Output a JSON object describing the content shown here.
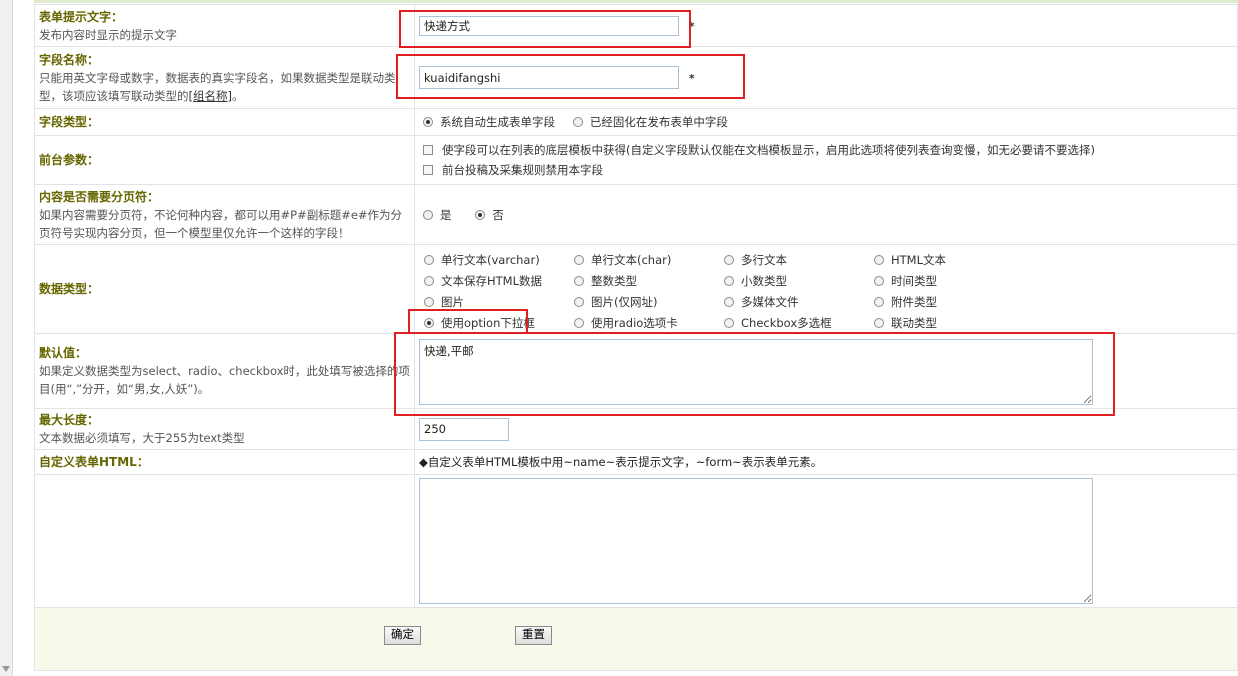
{
  "fields": {
    "prompt_text": {
      "label": "表单提示文字：",
      "desc": "发布内容时显示的提示文字",
      "value": "快递方式",
      "required": "*"
    },
    "field_name": {
      "label": "字段名称：",
      "desc": "只能用英文字母或数字，数据表的真实字段名，如果数据类型是联动类型，该项应该填写联动类型的",
      "desc_link": "[组名称]",
      "desc_end": "。",
      "value": "kuaidifangshi",
      "required": "*"
    },
    "field_type": {
      "label": "字段类型：",
      "options": [
        {
          "label": "系统自动生成表单字段",
          "checked": true
        },
        {
          "label": "已经固化在发布表单中字段",
          "checked": false
        }
      ]
    },
    "front_params": {
      "label": "前台参数：",
      "options": [
        {
          "label": "使字段可以在列表的底层模板中获得(自定义字段默认仅能在文档模板显示，启用此选项将使列表查询变慢，如无必要请不要选择)",
          "checked": false
        },
        {
          "label": "前台投稿及采集规则禁用本字段",
          "checked": false
        }
      ]
    },
    "page_break": {
      "label": "内容是否需要分页符：",
      "desc": "如果内容需要分页符，不论何种内容，都可以用#P#副标题#e#作为分页符号实现内容分页，但一个模型里仅允许一个这样的字段！",
      "options": [
        {
          "label": "是",
          "checked": false
        },
        {
          "label": "否",
          "checked": true
        }
      ]
    },
    "data_type": {
      "label": "数据类型：",
      "options": [
        {
          "label": "单行文本(varchar)",
          "checked": false
        },
        {
          "label": "单行文本(char)",
          "checked": false
        },
        {
          "label": "多行文本",
          "checked": false
        },
        {
          "label": "HTML文本",
          "checked": false
        },
        {
          "label": "文本保存HTML数据",
          "checked": false
        },
        {
          "label": "整数类型",
          "checked": false
        },
        {
          "label": "小数类型",
          "checked": false
        },
        {
          "label": "时间类型",
          "checked": false
        },
        {
          "label": "图片",
          "checked": false
        },
        {
          "label": "图片(仅网址)",
          "checked": false
        },
        {
          "label": "多媒体文件",
          "checked": false
        },
        {
          "label": "附件类型",
          "checked": false
        },
        {
          "label": "使用option下拉框",
          "checked": true
        },
        {
          "label": "使用radio选项卡",
          "checked": false
        },
        {
          "label": "Checkbox多选框",
          "checked": false
        },
        {
          "label": "联动类型",
          "checked": false
        }
      ]
    },
    "default_value": {
      "label": "默认值：",
      "desc": "如果定义数据类型为select、radio、checkbox时，此处填写被选择的项目(用“,”分开，如“男,女,人妖”)。",
      "value": "快递,平邮"
    },
    "max_length": {
      "label": "最大长度：",
      "desc": "文本数据必须填写，大于255为text类型",
      "value": "250"
    },
    "custom_html": {
      "label": "自定义表单HTML：",
      "hint": "◆自定义表单HTML模板中用~name~表示提示文字，~form~表示表单元素。",
      "value": ""
    }
  },
  "buttons": {
    "ok": "确定",
    "reset": "重置"
  },
  "colors": {
    "label": "#666600",
    "highlight": "#e02020",
    "input_border": "#a9c2d8",
    "footer_bg": "#f9f9eb"
  }
}
